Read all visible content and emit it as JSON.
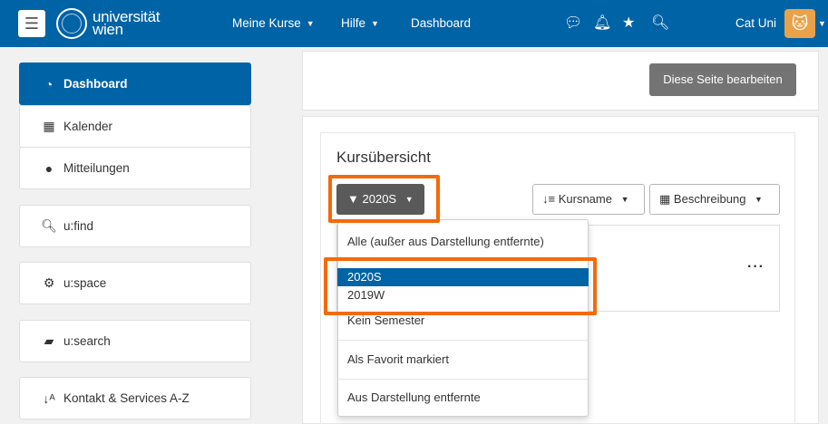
{
  "navbar": {
    "menu_icon": "hamburger-icon",
    "logo_text": "universität wien",
    "logo_line1": "universität",
    "logo_line2": "wien",
    "items": [
      {
        "label": "Meine Kurse"
      },
      {
        "label": "Hilfe"
      },
      {
        "label": "Dashboard"
      }
    ],
    "icons": [
      "chat-icon",
      "bell-icon",
      "star-icon",
      "search-icon"
    ],
    "user_name": "Cat Uni"
  },
  "sidebar": {
    "items": [
      {
        "label": "Dashboard",
        "icon": "dashboard-icon",
        "active": true
      },
      {
        "label": "Kalender",
        "icon": "calendar-icon"
      },
      {
        "label": "Mitteilungen",
        "icon": "chat-icon"
      },
      {
        "label": "u:find",
        "icon": "search-icon"
      },
      {
        "label": "u:space",
        "icon": "gear-icon"
      },
      {
        "label": "u:search",
        "icon": "book-icon"
      },
      {
        "label": "Kontakt & Services A-Z",
        "icon": "sort-alpha-icon"
      }
    ]
  },
  "main": {
    "edit_button": "Diese Seite bearbeiten",
    "section_title": "Kursübersicht",
    "filter": {
      "label": "2020S"
    },
    "sort": {
      "label": "Kursname"
    },
    "view": {
      "label": "Beschreibung"
    },
    "course_menu": "···",
    "dropdown": [
      {
        "label": "Alle (außer aus Darstellung entfernte)"
      },
      {
        "label": "2020S",
        "selected": true
      },
      {
        "label": "2019W"
      },
      {
        "label": "Kein Semester"
      },
      {
        "label": "Als Favorit markiert"
      },
      {
        "label": "Aus Darstellung entfernte"
      }
    ]
  },
  "colors": {
    "brand": "#0063a6",
    "highlight": "#f46a0a"
  }
}
